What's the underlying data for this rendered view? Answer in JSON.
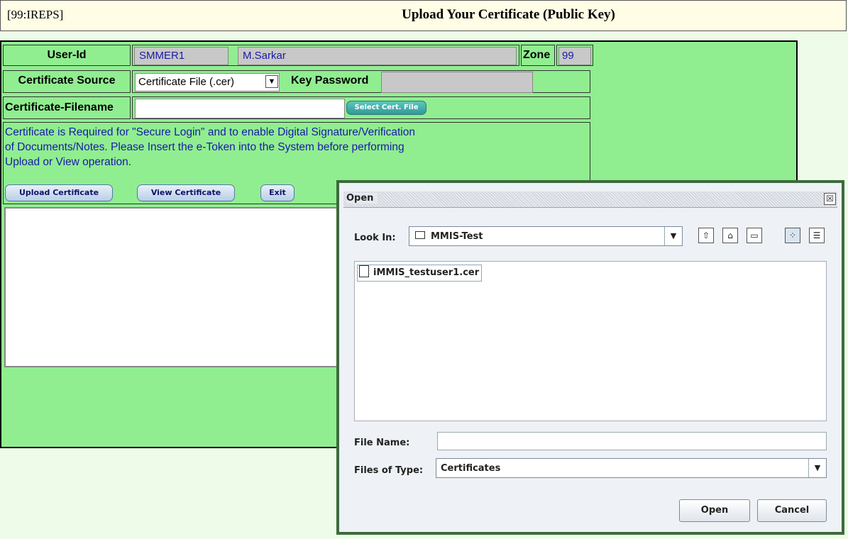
{
  "header": {
    "code": "[99:IREPS]",
    "title": "Upload Your Certificate (Public Key)"
  },
  "form": {
    "userid_label": "User-Id",
    "userid_value": "SMMER1",
    "username_value": "M.Sarkar",
    "zone_label": "Zone",
    "zone_value": "99",
    "cert_source_label": "Certificate Source",
    "cert_source_value": "Certificate File (.cer)",
    "key_password_label": "Key Password",
    "key_password_value": "",
    "cert_filename_label": "Certificate-Filename",
    "cert_filename_value": "",
    "select_cert_label": "Select Cert. File",
    "info_lines": [
      "Certificate is Required for \"Secure Login\" and to enable Digital Signature/Verification",
      "of Documents/Notes. Please Insert the e-Token into the System before performing",
      "Upload or View operation."
    ],
    "upload_label": "Upload Certificate",
    "view_label": "View Certificate",
    "exit_label": "Exit"
  },
  "dialog": {
    "title": "Open",
    "close_glyph": "☒",
    "look_in_label": "Look In:",
    "look_in_value": "MMIS-Test",
    "toolbar_icons": [
      "up-folder-icon",
      "home-icon",
      "new-folder-icon",
      "list-view-icon",
      "details-view-icon"
    ],
    "files": [
      "iMMIS_testuser1.cer"
    ],
    "file_name_label": "File Name:",
    "file_name_value": "",
    "files_of_type_label": "Files of Type:",
    "files_of_type_value": "Certificates",
    "open_label": "Open",
    "cancel_label": "Cancel"
  },
  "colors": {
    "panel": "#90ee90",
    "header_bg": "#fffde6",
    "page_bg": "#eefbe9",
    "dialog_border": "#3d6b3d",
    "text_blue": "#1a1aa8"
  }
}
